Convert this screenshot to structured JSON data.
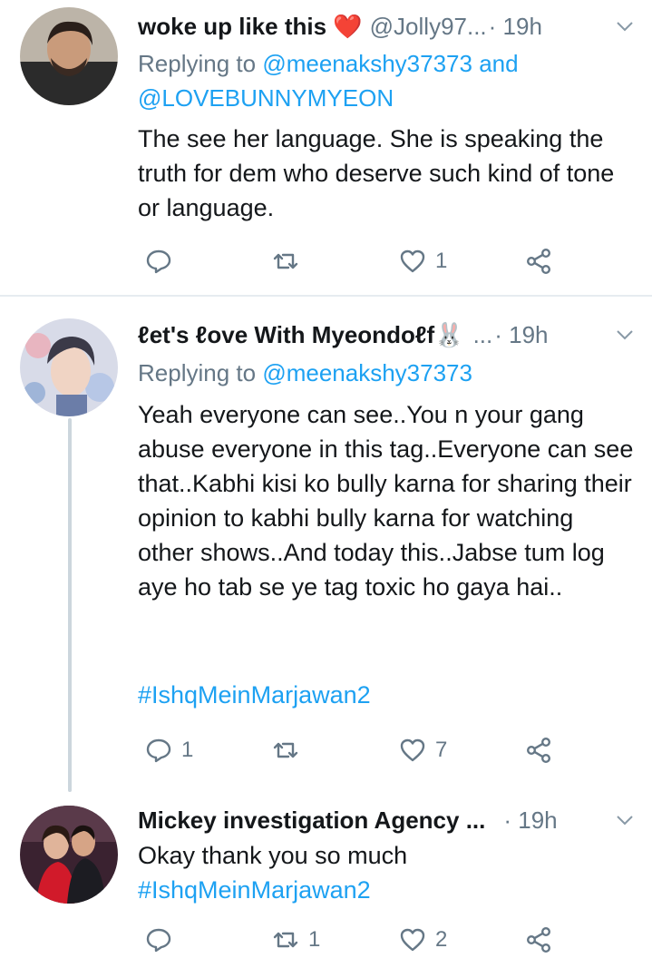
{
  "tweets": [
    {
      "name": "woke up like this ❤️",
      "handle": "@Jolly97...",
      "time": "· 19h",
      "replying_prefix": "Replying to ",
      "replying_mentions": "@meenakshy37373 and",
      "replying_mentions2": "@LOVEBUNNYMYEON",
      "text": "The see her language. She is speaking the truth for dem who deserve such kind of tone or language.",
      "reply_count": "",
      "retweet_count": "",
      "like_count": "1"
    },
    {
      "name": "ℓet's ℓove With Myeondoℓf🐰",
      "handle": "...",
      "time": "· 19h",
      "replying_prefix": "Replying to ",
      "replying_mentions": "@meenakshy37373",
      "text": "Yeah everyone can see..You n your gang abuse everyone in this tag..Everyone can see that..Kabhi kisi ko bully karna for sharing their opinion to kabhi bully karna for watching other shows..And today this..Jabse tum log aye ho tab se ye tag toxic ho gaya hai..",
      "hashtag": "#IshqMeinMarjawan2",
      "reply_count": "1",
      "retweet_count": "",
      "like_count": "7"
    },
    {
      "name": "Mickey investigation Agency ...",
      "time": "· 19h",
      "text": "Okay thank you so much",
      "hashtag": "#IshqMeinMarjawan2",
      "reply_count": "",
      "retweet_count": "1",
      "like_count": "2"
    }
  ],
  "icons": {
    "reply": "reply-icon",
    "retweet": "retweet-icon",
    "like": "heart-icon",
    "share": "share-icon",
    "more": "chevron-down-icon"
  },
  "colors": {
    "link": "#1da1f2",
    "muted": "#657786",
    "text": "#14171a",
    "divider": "#e6ecf0",
    "thread_line": "#ccd6dd"
  }
}
